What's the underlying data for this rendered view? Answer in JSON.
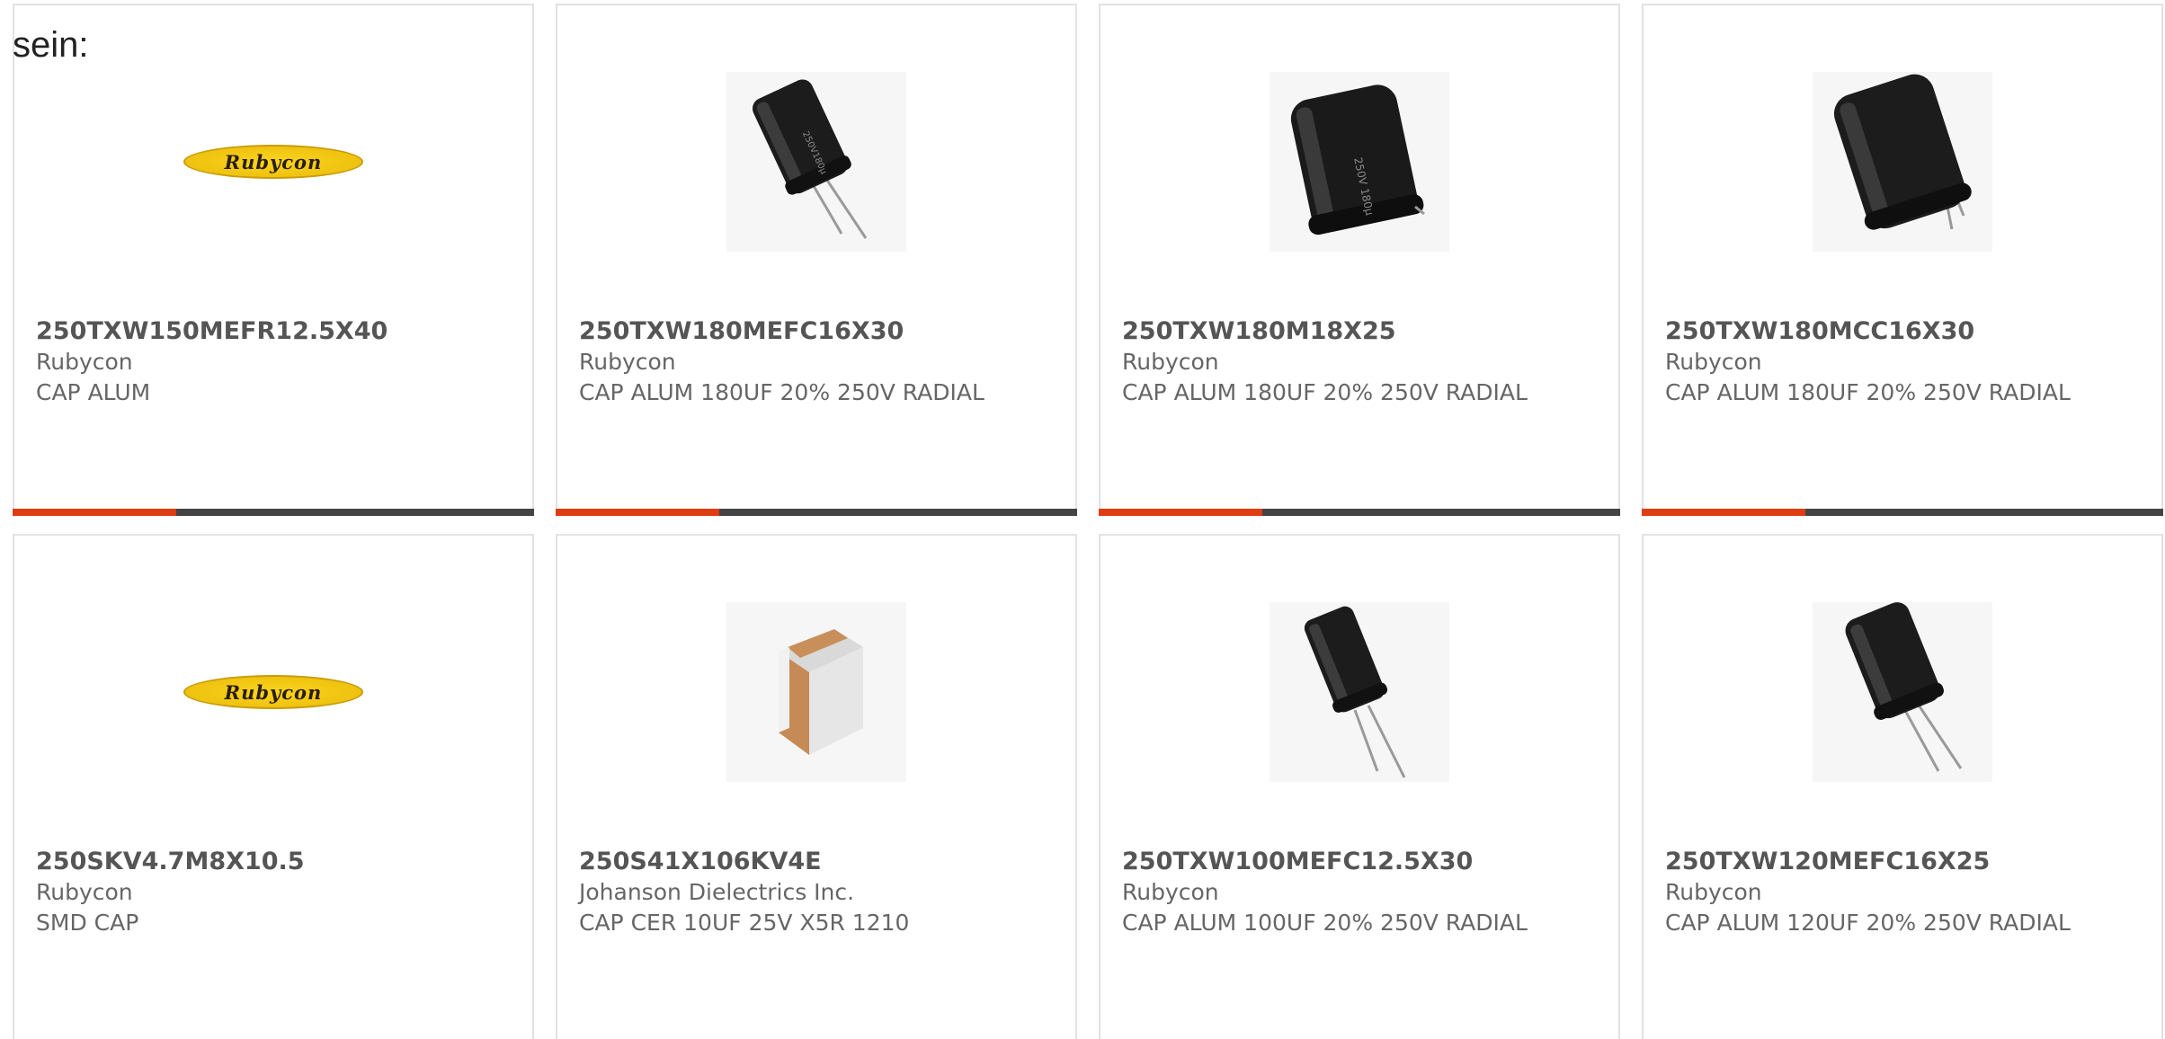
{
  "intro": {
    "text": "sein:"
  },
  "products": [
    {
      "part": "250TXW150MEFR12.5X40",
      "manufacturer": "Rubycon",
      "description": "CAP ALUM",
      "image": "rubycon-logo",
      "logo_text": "Rubycon"
    },
    {
      "part": "250TXW180MEFC16X30",
      "manufacturer": "Rubycon",
      "description": "CAP ALUM 180UF 20% 250V RADIAL",
      "image": "radial-capacitor-icon"
    },
    {
      "part": "250TXW180M18X25",
      "manufacturer": "Rubycon",
      "description": "CAP ALUM 180UF 20% 250V RADIAL",
      "image": "snap-in-capacitor-icon"
    },
    {
      "part": "250TXW180MCC16X30",
      "manufacturer": "Rubycon",
      "description": "CAP ALUM 180UF 20% 250V RADIAL",
      "image": "short-lead-capacitor-icon"
    },
    {
      "part": "250SKV4.7M8X10.5",
      "manufacturer": "Rubycon",
      "description": "SMD CAP",
      "image": "rubycon-logo",
      "logo_text": "Rubycon"
    },
    {
      "part": "250S41X106KV4E",
      "manufacturer": "Johanson Dielectrics Inc.",
      "description": "CAP CER 10UF 25V X5R 1210",
      "image": "ceramic-chip-capacitor-icon"
    },
    {
      "part": "250TXW100MEFC12.5X30",
      "manufacturer": "Rubycon",
      "description": "CAP ALUM 100UF 20% 250V RADIAL",
      "image": "radial-capacitor-icon"
    },
    {
      "part": "250TXW120MEFC16X25",
      "manufacturer": "Rubycon",
      "description": "CAP ALUM 120UF 20% 250V RADIAL",
      "image": "radial-capacitor-icon"
    }
  ],
  "colors": {
    "accent_bar": "#e03c14",
    "dark_bar": "#444444",
    "card_border": "#e2e2e2",
    "logo_yellow": "#f9d51e"
  }
}
